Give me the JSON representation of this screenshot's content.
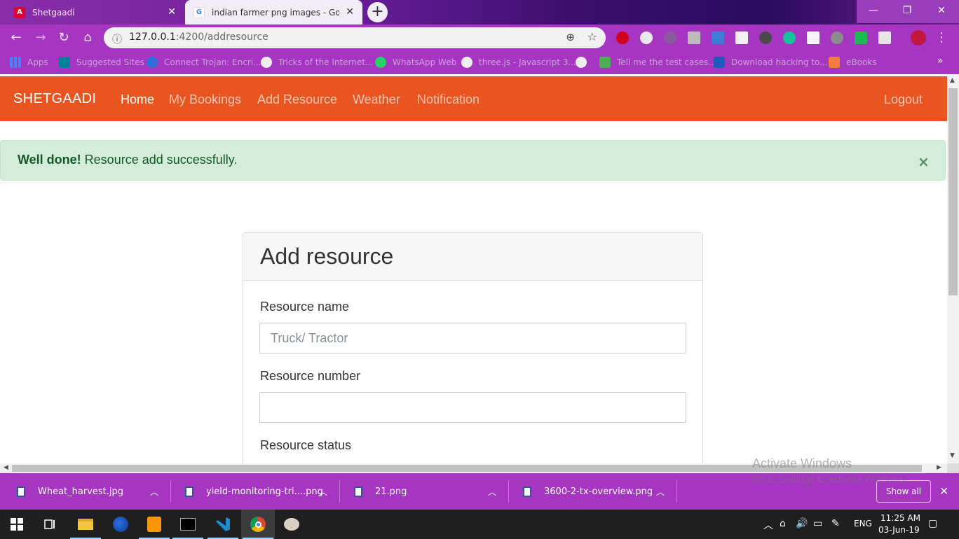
{
  "browser": {
    "tabs": [
      {
        "title": "Shetgaadi",
        "favicon": "angular-icon",
        "active": false
      },
      {
        "title": "indian farmer png images - Google",
        "favicon": "google-icon",
        "active": true
      }
    ],
    "new_tab": "+",
    "window_controls": {
      "minimize": "—",
      "maximize": "❐",
      "close": "✕"
    },
    "nav": {
      "back": "←",
      "forward": "→",
      "reload": "↻",
      "home": "⌂"
    },
    "address": {
      "host": "127.0.0.1",
      "path": ":4200/addresource",
      "info_icon": "ⓘ",
      "zoom_icon": "⊕",
      "star_icon": "☆"
    },
    "bookmarks": [
      {
        "label": "Apps",
        "icon": "apps-grid-icon"
      },
      {
        "label": "Suggested Sites",
        "icon": "bing-icon"
      },
      {
        "label": "Connect Trojan: Encri...",
        "icon": "trojan-icon"
      },
      {
        "label": "Tricks of the Internet...",
        "icon": "globe-icon"
      },
      {
        "label": "WhatsApp Web",
        "icon": "whatsapp-icon"
      },
      {
        "label": "three.js - Javascript 3...",
        "icon": "globe-icon"
      },
      {
        "label": "",
        "icon": "globe-icon"
      },
      {
        "label": "Tell me the test cases...",
        "icon": "test-icon"
      },
      {
        "label": "Download hacking to...",
        "icon": "s-icon"
      },
      {
        "label": "eBooks",
        "icon": "plus-icon"
      }
    ],
    "bookmarks_overflow": "»"
  },
  "app": {
    "brand": "SHETGAADI",
    "nav": {
      "home": "Home",
      "bookings": "My Bookings",
      "add_resource": "Add Resource",
      "weather": "Weather",
      "notification": "Notification",
      "logout": "Logout"
    },
    "alert": {
      "strong": "Well done!",
      "message": " Resource add successfully.",
      "close": "×"
    },
    "form": {
      "title": "Add resource",
      "resource_name_label": "Resource name",
      "resource_name_placeholder": "Truck/ Tractor",
      "resource_number_label": "Resource number",
      "resource_number_value": "",
      "resource_status_label": "Resource status"
    }
  },
  "watermark": {
    "line1": "Activate Windows",
    "line2": "Go to Settings to activate Windows."
  },
  "downloads": {
    "items": [
      "Wheat_harvest.jpg",
      "yield-monitoring-tri....png",
      "21.png",
      "3600-2-tx-overview.png"
    ],
    "show_all": "Show all",
    "close": "✕"
  },
  "taskbar": {
    "language": "ENG",
    "time": "11:25 AM",
    "date": "03-Jun-19"
  },
  "colors": {
    "navbar": "#e95420",
    "alert_bg": "#d4edda",
    "alert_text": "#155724",
    "browser_chrome": "#a635c2"
  }
}
